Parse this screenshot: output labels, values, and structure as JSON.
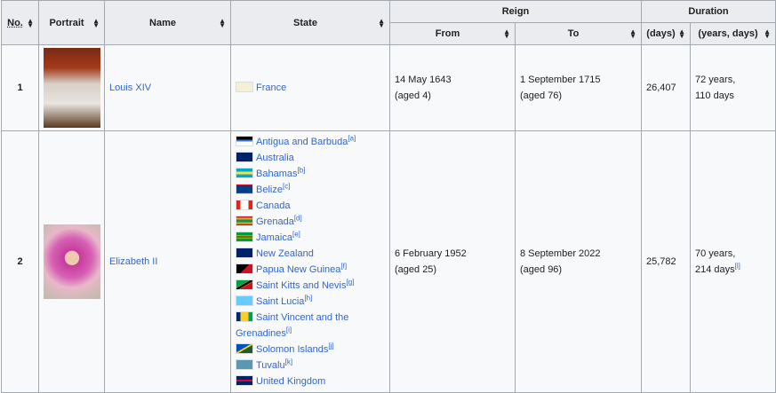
{
  "headers": {
    "no": "No.",
    "portrait": "Portrait",
    "name": "Name",
    "state": "State",
    "reign": "Reign",
    "from": "From",
    "to": "To",
    "duration": "Duration",
    "days": "(days)",
    "years_days": "(years, days)"
  },
  "rows": [
    {
      "no": "1",
      "name": "Louis XIV",
      "states": [
        {
          "name": "France",
          "flag": "#f4f0d8",
          "note": ""
        }
      ],
      "from": "14 May 1643",
      "from_age": "(aged 4)",
      "to": "1 September 1715",
      "to_age": "(aged 76)",
      "days": "26,407",
      "years": "72 years,",
      "ydays": "110 days",
      "dnote": ""
    },
    {
      "no": "2",
      "name": "Elizabeth II",
      "states": [
        {
          "name": "Antigua and Barbuda",
          "flag": "linear-gradient(#000 33%,#3a7dce 33%,#3a7dce 55%,#fff 55%)",
          "note": "[a]"
        },
        {
          "name": "Australia",
          "flag": "#012169",
          "note": ""
        },
        {
          "name": "Bahamas",
          "flag": "linear-gradient(#00abc9 33%,#fae042 33%,#fae042 66%,#00abc9 66%)",
          "note": "[b]"
        },
        {
          "name": "Belize",
          "flag": "linear-gradient(#ce1126 12%,#003f87 12%,#003f87 88%,#ce1126 88%)",
          "note": "[c]"
        },
        {
          "name": "Canada",
          "flag": "linear-gradient(90deg,#d52b1e 25%,#fff 25%,#fff 75%,#d52b1e 75%)",
          "note": ""
        },
        {
          "name": "Grenada",
          "flag": "linear-gradient(#ce1126 15%,#fcd116 15%,#007a5e 50%,#fcd116 85%,#ce1126 85%)",
          "note": "[d]"
        },
        {
          "name": "Jamaica",
          "flag": "linear-gradient(#009b3a 30%,#fed100 40%,#000 50%,#fed100 60%,#009b3a 70%)",
          "note": "[e]"
        },
        {
          "name": "New Zealand",
          "flag": "#012169",
          "note": ""
        },
        {
          "name": "Papua New Guinea",
          "flag": "linear-gradient(135deg,#000 50%,#ce1126 50%)",
          "note": "[f]"
        },
        {
          "name": "Saint Kitts and Nevis",
          "flag": "linear-gradient(150deg,#009e49 40%,#fcd116 40%,#000 45%,#000 55%,#fcd116 60%,#ce1126 60%)",
          "note": "[g]"
        },
        {
          "name": "Saint Lucia",
          "flag": "#66ccff",
          "note": "[h]"
        },
        {
          "name": "Saint Vincent and the Grenadines",
          "flag": "linear-gradient(90deg,#002674 25%,#fcd022 25%,#fcd022 75%,#009e60 75%)",
          "note": "[i]"
        },
        {
          "name": "Solomon Islands",
          "flag": "linear-gradient(150deg,#0051ba 45%,#fcd116 45%,#fcd116 55%,#215b33 55%)",
          "note": "[j]"
        },
        {
          "name": "Tuvalu",
          "flag": "#5b97b1",
          "note": "[k]"
        },
        {
          "name": "United Kingdom",
          "flag": "linear-gradient(#012169 40%,#c8102e 40%,#c8102e 60%,#012169 60%)",
          "note": ""
        }
      ],
      "from": "6 February 1952",
      "from_age": "(aged 25)",
      "to": "8 September 2022",
      "to_age": "(aged 96)",
      "days": "25,782",
      "years": "70 years,",
      "ydays": "214 days",
      "dnote": "[l]"
    }
  ]
}
